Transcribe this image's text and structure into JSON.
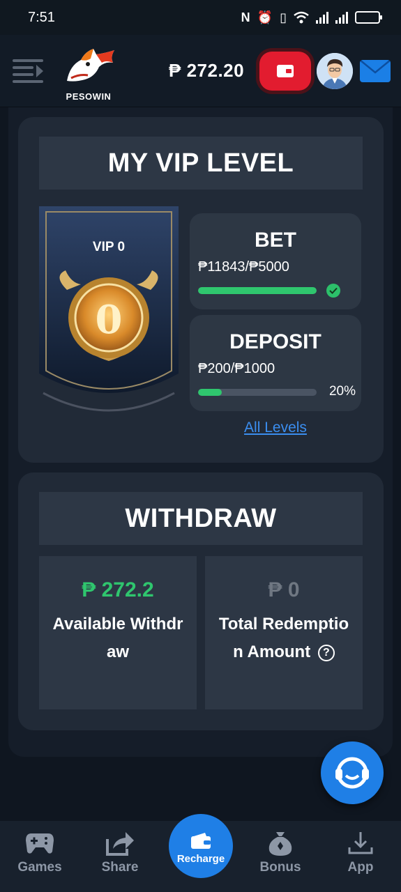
{
  "status_bar": {
    "time": "7:51"
  },
  "header": {
    "logo_text": "PESOWIN",
    "balance": "₱ 272.20"
  },
  "vip": {
    "title": "MY VIP LEVEL",
    "level_label": "VIP 0",
    "badge_digit": "0",
    "bet": {
      "title": "BET",
      "amount": "₱11843/₱5000",
      "progress": 1.0
    },
    "deposit": {
      "title": "DEPOSIT",
      "amount": "₱200/₱1000",
      "progress": 0.2,
      "percent_text": "20%"
    },
    "all_levels_link": "All Levels"
  },
  "withdraw": {
    "title": "WITHDRAW",
    "available": {
      "amount": "₱ 272.2",
      "label": "Available Withdraw"
    },
    "redemption": {
      "amount": "₱ 0",
      "label": "Total Redemption Amount",
      "help_icon": "?"
    }
  },
  "bottom_nav": {
    "items": [
      {
        "label": "Games",
        "icon": "gamepad-icon"
      },
      {
        "label": "Share",
        "icon": "share-icon"
      },
      {
        "label": "Recharge",
        "icon": "wallet-icon"
      },
      {
        "label": "Bonus",
        "icon": "money-bag-icon"
      },
      {
        "label": "App",
        "icon": "download-icon"
      }
    ]
  },
  "colors": {
    "accent_blue": "#1f7fe6",
    "accent_red": "#e21c2f",
    "success_green": "#2fc66e",
    "panel": "#212a37"
  }
}
